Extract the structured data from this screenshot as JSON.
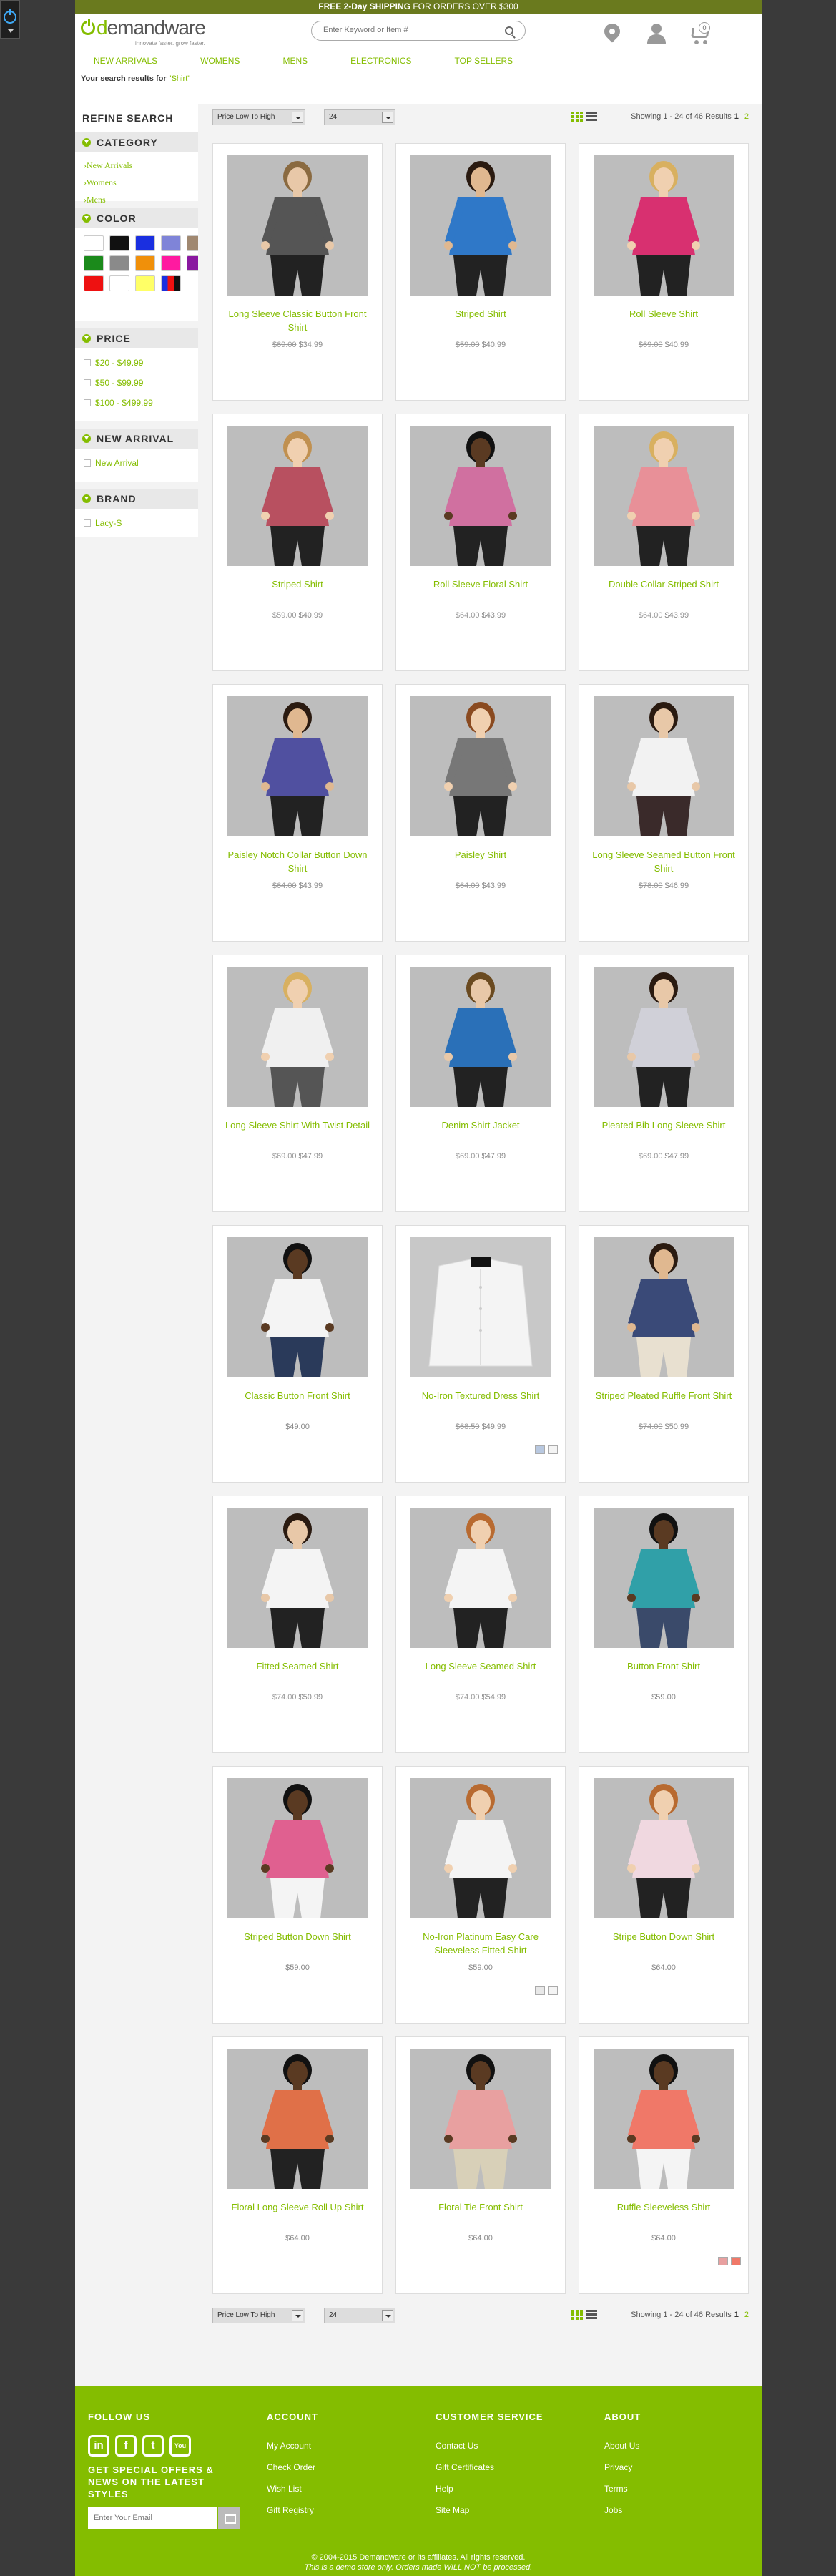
{
  "promo": {
    "bold": "FREE 2-Day SHIPPING",
    "rest": " FOR ORDERS OVER $300"
  },
  "header": {
    "logo_d": "d",
    "logo_rest": "emandware",
    "tagline": "innovate faster. grow faster.",
    "search_placeholder": "Enter Keyword or Item #",
    "cart_count": "0"
  },
  "nav": [
    "NEW ARRIVALS",
    "WOMENS",
    "MENS",
    "ELECTRONICS",
    "TOP SELLERS"
  ],
  "breadcrumb": {
    "prefix": "Your search results for ",
    "term": "\"Shirt\""
  },
  "refine": {
    "title": "REFINE SEARCH",
    "category_title": "CATEGORY",
    "categories": [
      "New Arrivals",
      "Womens",
      "Mens"
    ],
    "color_title": "COLOR",
    "colors": [
      "#ffffff",
      "#111111",
      "#1a2fe0",
      "#7f84d8",
      "#a08870",
      "#1b8a1b",
      "#8a8a8a",
      "#f0900a",
      "#ff1aa0",
      "#8a18a0",
      "#ee1111",
      "#ffffff",
      "#ffff66",
      "#multi"
    ],
    "price_title": "PRICE",
    "prices": [
      "$20 - $49.99",
      "$50 - $99.99",
      "$100 - $499.99"
    ],
    "newarrival_title": "NEW ARRIVAL",
    "newarrival": [
      "New Arrival"
    ],
    "brand_title": "BRAND",
    "brands": [
      "Lacy-S"
    ]
  },
  "toolbar": {
    "sort_label": "Price Low To High",
    "page_size": "24",
    "results_text": "Showing 1 - 24 of 46 Results",
    "page_current": "1",
    "page_next": "2"
  },
  "products": [
    {
      "name": "Long Sleeve Classic Button Front Shirt",
      "old": "$69.00",
      "price": "$34.99",
      "skin": "#e8c8a8",
      "hair": "#8a6a40",
      "top": "#555555",
      "bottom": "#222222"
    },
    {
      "name": "Striped Shirt",
      "old": "$59.00",
      "price": "$40.99",
      "skin": "#e0b890",
      "hair": "#2a1a10",
      "top": "#2f78c8",
      "bottom": "#222222"
    },
    {
      "name": "Roll Sleeve Shirt",
      "old": "$69.00",
      "price": "$40.99",
      "skin": "#f0d0b0",
      "hair": "#d8b060",
      "top": "#d83070",
      "bottom": "#222222"
    },
    {
      "name": "Striped Shirt",
      "old": "$59.00",
      "price": "$40.99",
      "skin": "#f0d0b0",
      "hair": "#c09050",
      "top": "#b85060",
      "bottom": "#222222"
    },
    {
      "name": "Roll Sleeve Floral Shirt",
      "old": "$64.00",
      "price": "$43.99",
      "skin": "#5a3a22",
      "hair": "#111111",
      "top": "#d070a0",
      "bottom": "#222222"
    },
    {
      "name": "Double Collar Striped Shirt",
      "old": "$64.00",
      "price": "$43.99",
      "skin": "#f0d0b0",
      "hair": "#d8b060",
      "top": "#e89098",
      "bottom": "#222222"
    },
    {
      "name": "Paisley Notch Collar Button Down Shirt",
      "old": "$64.00",
      "price": "$43.99",
      "skin": "#e0b890",
      "hair": "#2a1a10",
      "top": "#5050a0",
      "bottom": "#222222"
    },
    {
      "name": "Paisley Shirt",
      "old": "$64.00",
      "price": "$43.99",
      "skin": "#f0d0b0",
      "hair": "#8a4a20",
      "top": "#777777",
      "bottom": "#222222"
    },
    {
      "name": "Long Sleeve Seamed Button Front Shirt",
      "old": "$78.00",
      "price": "$46.99",
      "skin": "#e8c8a8",
      "hair": "#2a1a10",
      "top": "#f2f2f2",
      "bottom": "#3a2a2a"
    },
    {
      "name": "Long Sleeve Shirt With Twist Detail",
      "old": "$69.00",
      "price": "$47.99",
      "skin": "#f0d0b0",
      "hair": "#d8b060",
      "top": "#f0f0f0",
      "bottom": "#555555"
    },
    {
      "name": "Denim Shirt Jacket",
      "old": "$69.00",
      "price": "$47.99",
      "skin": "#e8c8a8",
      "hair": "#6a4a20",
      "top": "#2a70b8",
      "bottom": "#222222"
    },
    {
      "name": "Pleated Bib Long Sleeve Shirt",
      "old": "$69.00",
      "price": "$47.99",
      "skin": "#e8c8a8",
      "hair": "#2a1a10",
      "top": "#d0d0d8",
      "bottom": "#222222"
    },
    {
      "name": "Classic Button Front Shirt",
      "old": "",
      "price": "$49.00",
      "skin": "#5a3a22",
      "hair": "#111111",
      "top": "#f4f4f4",
      "bottom": "#2a3a5a"
    },
    {
      "name": "No-Iron Textured Dress Shirt",
      "old": "$68.50",
      "price": "$49.99",
      "skin": "",
      "hair": "",
      "top": "#f4f4f4",
      "bottom": "",
      "flat": true
    },
    {
      "name": "Striped Pleated Ruffle Front Shirt",
      "old": "$74.00",
      "price": "$50.99",
      "skin": "#e0b890",
      "hair": "#2a1a10",
      "top": "#3a4a78",
      "bottom": "#e8e0d0"
    },
    {
      "name": "Fitted Seamed Shirt",
      "old": "$74.00",
      "price": "$50.99",
      "skin": "#e8c8a8",
      "hair": "#2a1a10",
      "top": "#f4f4f4",
      "bottom": "#222222"
    },
    {
      "name": "Long Sleeve Seamed Shirt",
      "old": "$74.00",
      "price": "$54.99",
      "skin": "#f0d0b0",
      "hair": "#b86a30",
      "top": "#f4f4f4",
      "bottom": "#222222"
    },
    {
      "name": "Button Front Shirt",
      "old": "",
      "price": "$59.00",
      "skin": "#5a3a22",
      "hair": "#111111",
      "top": "#30a0a8",
      "bottom": "#3a4a6a"
    },
    {
      "name": "Striped Button Down Shirt",
      "old": "",
      "price": "$59.00",
      "skin": "#5a3a22",
      "hair": "#111111",
      "top": "#e06090",
      "bottom": "#f4f4f4"
    },
    {
      "name": "No-Iron Platinum Easy Care Sleeveless Fitted Shirt",
      "old": "",
      "price": "$59.00",
      "skin": "#f0d0b0",
      "hair": "#b86a30",
      "top": "#f4f4f4",
      "bottom": "#222222"
    },
    {
      "name": "Stripe Button Down Shirt",
      "old": "",
      "price": "$64.00",
      "skin": "#f0d0b0",
      "hair": "#b86a30",
      "top": "#f0d8e0",
      "bottom": "#222222"
    },
    {
      "name": "Floral Long Sleeve Roll Up Shirt",
      "old": "",
      "price": "$64.00",
      "skin": "#5a3a22",
      "hair": "#111111",
      "top": "#e07048",
      "bottom": "#222222"
    },
    {
      "name": "Floral Tie Front Shirt",
      "old": "",
      "price": "$64.00",
      "skin": "#5a3a22",
      "hair": "#111111",
      "top": "#e8a0a0",
      "bottom": "#d8d0b8"
    },
    {
      "name": "Ruffle Sleeveless Shirt",
      "old": "",
      "price": "$64.00",
      "skin": "#5a3a22",
      "hair": "#111111",
      "top": "#f07868",
      "bottom": "#f4f4f4"
    }
  ],
  "mini_swatches": {
    "13": [
      "#b8c8e0",
      "#f4f4f4"
    ],
    "19": [
      "#e8e8e8",
      "#f4f4f4"
    ],
    "23": [
      "#e8a0a0",
      "#f07868"
    ]
  },
  "footer": {
    "follow_title": "FOLLOW US",
    "social": [
      "in",
      "f",
      "t",
      "You"
    ],
    "offers": "GET SPECIAL OFFERS & NEWS ON THE LATEST STYLES",
    "email_placeholder": "Enter Your Email",
    "account_title": "ACCOUNT",
    "account": [
      "My Account",
      "Check Order",
      "Wish List",
      "Gift Registry"
    ],
    "service_title": "CUSTOMER SERVICE",
    "service": [
      "Contact Us",
      "Gift Certificates",
      "Help",
      "Site Map"
    ],
    "about_title": "ABOUT",
    "about": [
      "About Us",
      "Privacy",
      "Terms",
      "Jobs"
    ],
    "copyright": "© 2004-2015 Demandware or its affiliates. All rights reserved.",
    "disclaimer": "This is a demo store only. Orders made WILL NOT be processed."
  }
}
